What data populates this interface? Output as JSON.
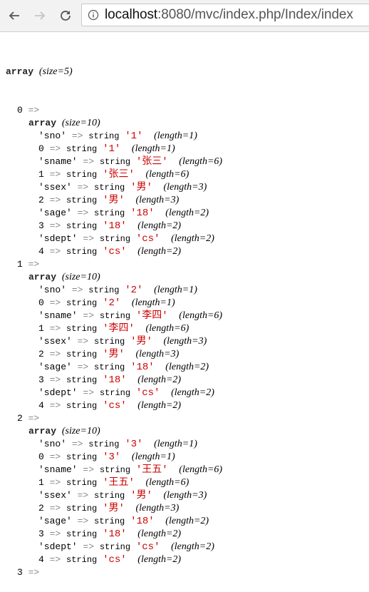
{
  "browser": {
    "url_host": "localhost",
    "url_rest": ":8080/mvc/index.php/Index/index",
    "icons": {
      "back": "back-arrow-icon",
      "forward": "forward-arrow-icon",
      "reload": "reload-icon",
      "info": "info-icon"
    }
  },
  "dump": {
    "root_keyword": "array",
    "root_meta": "(size=5)",
    "arrow": "=>",
    "string_kw": "string",
    "entries": [
      {
        "index": "0",
        "keyword": "array",
        "meta": "(size=10)",
        "rows": [
          {
            "key": "'sno'",
            "value": "'1'",
            "len": "(length=1)"
          },
          {
            "key": "0",
            "value": "'1'",
            "len": "(length=1)"
          },
          {
            "key": "'sname'",
            "value": "'张三'",
            "len": "(length=6)"
          },
          {
            "key": "1",
            "value": "'张三'",
            "len": "(length=6)"
          },
          {
            "key": "'ssex'",
            "value": "'男'",
            "len": "(length=3)"
          },
          {
            "key": "2",
            "value": "'男'",
            "len": "(length=3)"
          },
          {
            "key": "'sage'",
            "value": "'18'",
            "len": "(length=2)"
          },
          {
            "key": "3",
            "value": "'18'",
            "len": "(length=2)"
          },
          {
            "key": "'sdept'",
            "value": "'cs'",
            "len": "(length=2)"
          },
          {
            "key": "4",
            "value": "'cs'",
            "len": "(length=2)"
          }
        ]
      },
      {
        "index": "1",
        "keyword": "array",
        "meta": "(size=10)",
        "rows": [
          {
            "key": "'sno'",
            "value": "'2'",
            "len": "(length=1)"
          },
          {
            "key": "0",
            "value": "'2'",
            "len": "(length=1)"
          },
          {
            "key": "'sname'",
            "value": "'李四'",
            "len": "(length=6)"
          },
          {
            "key": "1",
            "value": "'李四'",
            "len": "(length=6)"
          },
          {
            "key": "'ssex'",
            "value": "'男'",
            "len": "(length=3)"
          },
          {
            "key": "2",
            "value": "'男'",
            "len": "(length=3)"
          },
          {
            "key": "'sage'",
            "value": "'18'",
            "len": "(length=2)"
          },
          {
            "key": "3",
            "value": "'18'",
            "len": "(length=2)"
          },
          {
            "key": "'sdept'",
            "value": "'cs'",
            "len": "(length=2)"
          },
          {
            "key": "4",
            "value": "'cs'",
            "len": "(length=2)"
          }
        ]
      },
      {
        "index": "2",
        "keyword": "array",
        "meta": "(size=10)",
        "rows": [
          {
            "key": "'sno'",
            "value": "'3'",
            "len": "(length=1)"
          },
          {
            "key": "0",
            "value": "'3'",
            "len": "(length=1)"
          },
          {
            "key": "'sname'",
            "value": "'王五'",
            "len": "(length=6)"
          },
          {
            "key": "1",
            "value": "'王五'",
            "len": "(length=6)"
          },
          {
            "key": "'ssex'",
            "value": "'男'",
            "len": "(length=3)"
          },
          {
            "key": "2",
            "value": "'男'",
            "len": "(length=3)"
          },
          {
            "key": "'sage'",
            "value": "'18'",
            "len": "(length=2)"
          },
          {
            "key": "3",
            "value": "'18'",
            "len": "(length=2)"
          },
          {
            "key": "'sdept'",
            "value": "'cs'",
            "len": "(length=2)"
          },
          {
            "key": "4",
            "value": "'cs'",
            "len": "(length=2)"
          }
        ]
      }
    ],
    "next_index": "3"
  }
}
